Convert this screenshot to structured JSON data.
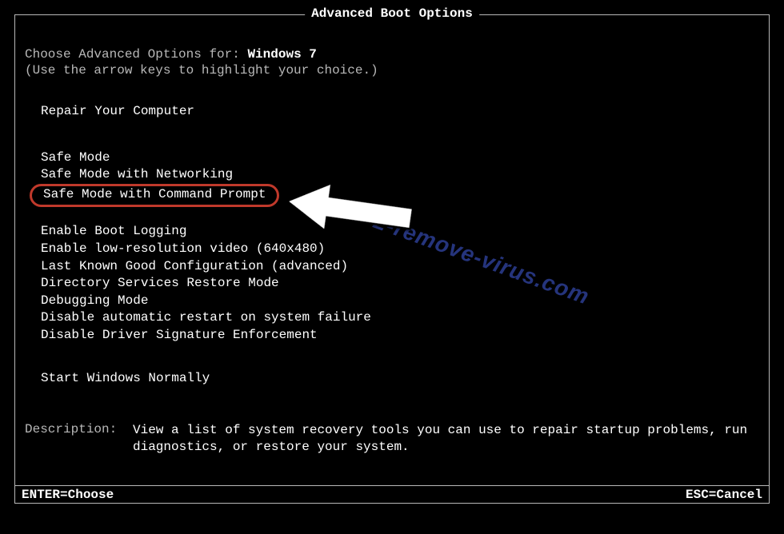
{
  "title": "Advanced Boot Options",
  "prompt": {
    "prefix": "Choose Advanced Options for: ",
    "os": "Windows 7",
    "hint": "(Use the arrow keys to highlight your choice.)"
  },
  "groups": {
    "g1": [
      "Repair Your Computer"
    ],
    "g2": [
      "Safe Mode",
      "Safe Mode with Networking",
      "Safe Mode with Command Prompt"
    ],
    "g3": [
      "Enable Boot Logging",
      "Enable low-resolution video (640x480)",
      "Last Known Good Configuration (advanced)",
      "Directory Services Restore Mode",
      "Debugging Mode",
      "Disable automatic restart on system failure",
      "Disable Driver Signature Enforcement"
    ],
    "g4": [
      "Start Windows Normally"
    ]
  },
  "highlighted_option": "Safe Mode with Command Prompt",
  "description": {
    "label": "Description:",
    "text": "View a list of system recovery tools you can use to repair startup problems, run diagnostics, or restore your system."
  },
  "footer": {
    "enter": "ENTER=Choose",
    "esc": "ESC=Cancel"
  },
  "watermark": "2-remove-virus.com"
}
